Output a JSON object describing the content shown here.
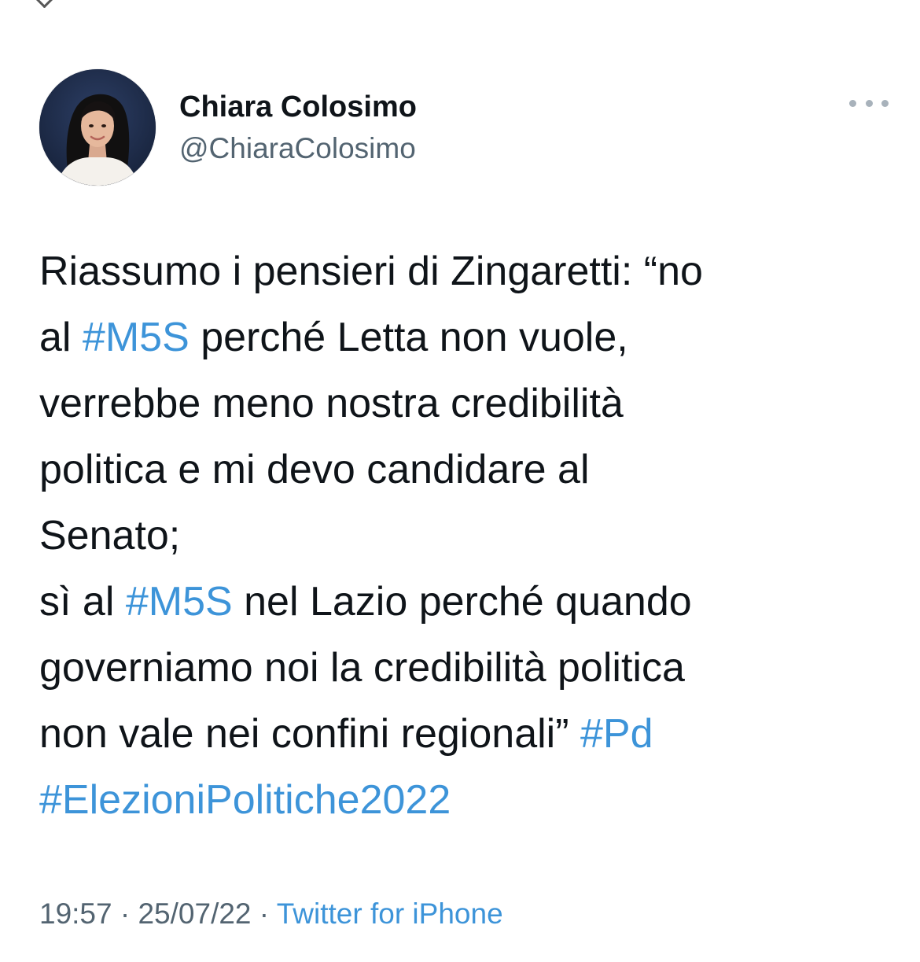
{
  "tweet": {
    "author": {
      "display_name": "Chiara Colosimo",
      "handle": "@ChiaraColosimo",
      "avatar_icon": "profile-photo"
    },
    "more_icon": "more-horizontal-icon",
    "text_lines": [
      [
        {
          "t": "Riassumo i pensieri di Zingaretti: “no",
          "tag": false
        }
      ],
      [
        {
          "t": "al ",
          "tag": false
        },
        {
          "t": "#M5S",
          "tag": true
        },
        {
          "t": " perché Letta non vuole,",
          "tag": false
        }
      ],
      [
        {
          "t": "verrebbe meno nostra credibilità",
          "tag": false
        }
      ],
      [
        {
          "t": "politica e mi devo candidare al",
          "tag": false
        }
      ],
      [
        {
          "t": "Senato;",
          "tag": false
        }
      ],
      [
        {
          "t": "sì al ",
          "tag": false
        },
        {
          "t": "#M5S",
          "tag": true
        },
        {
          "t": " nel Lazio perché quando",
          "tag": false
        }
      ],
      [
        {
          "t": "governiamo noi la credibilità politica",
          "tag": false
        }
      ],
      [
        {
          "t": "non vale nei confini regionali” ",
          "tag": false
        },
        {
          "t": "#Pd",
          "tag": true
        }
      ],
      [
        {
          "t": "#ElezioniPolitiche2022",
          "tag": true
        }
      ]
    ],
    "time": "19:57",
    "separator": " · ",
    "date": "25/07/22",
    "source": "Twitter for iPhone"
  },
  "colors": {
    "link": "#3d94d9",
    "text": "#0f1419",
    "secondary": "#536471"
  }
}
